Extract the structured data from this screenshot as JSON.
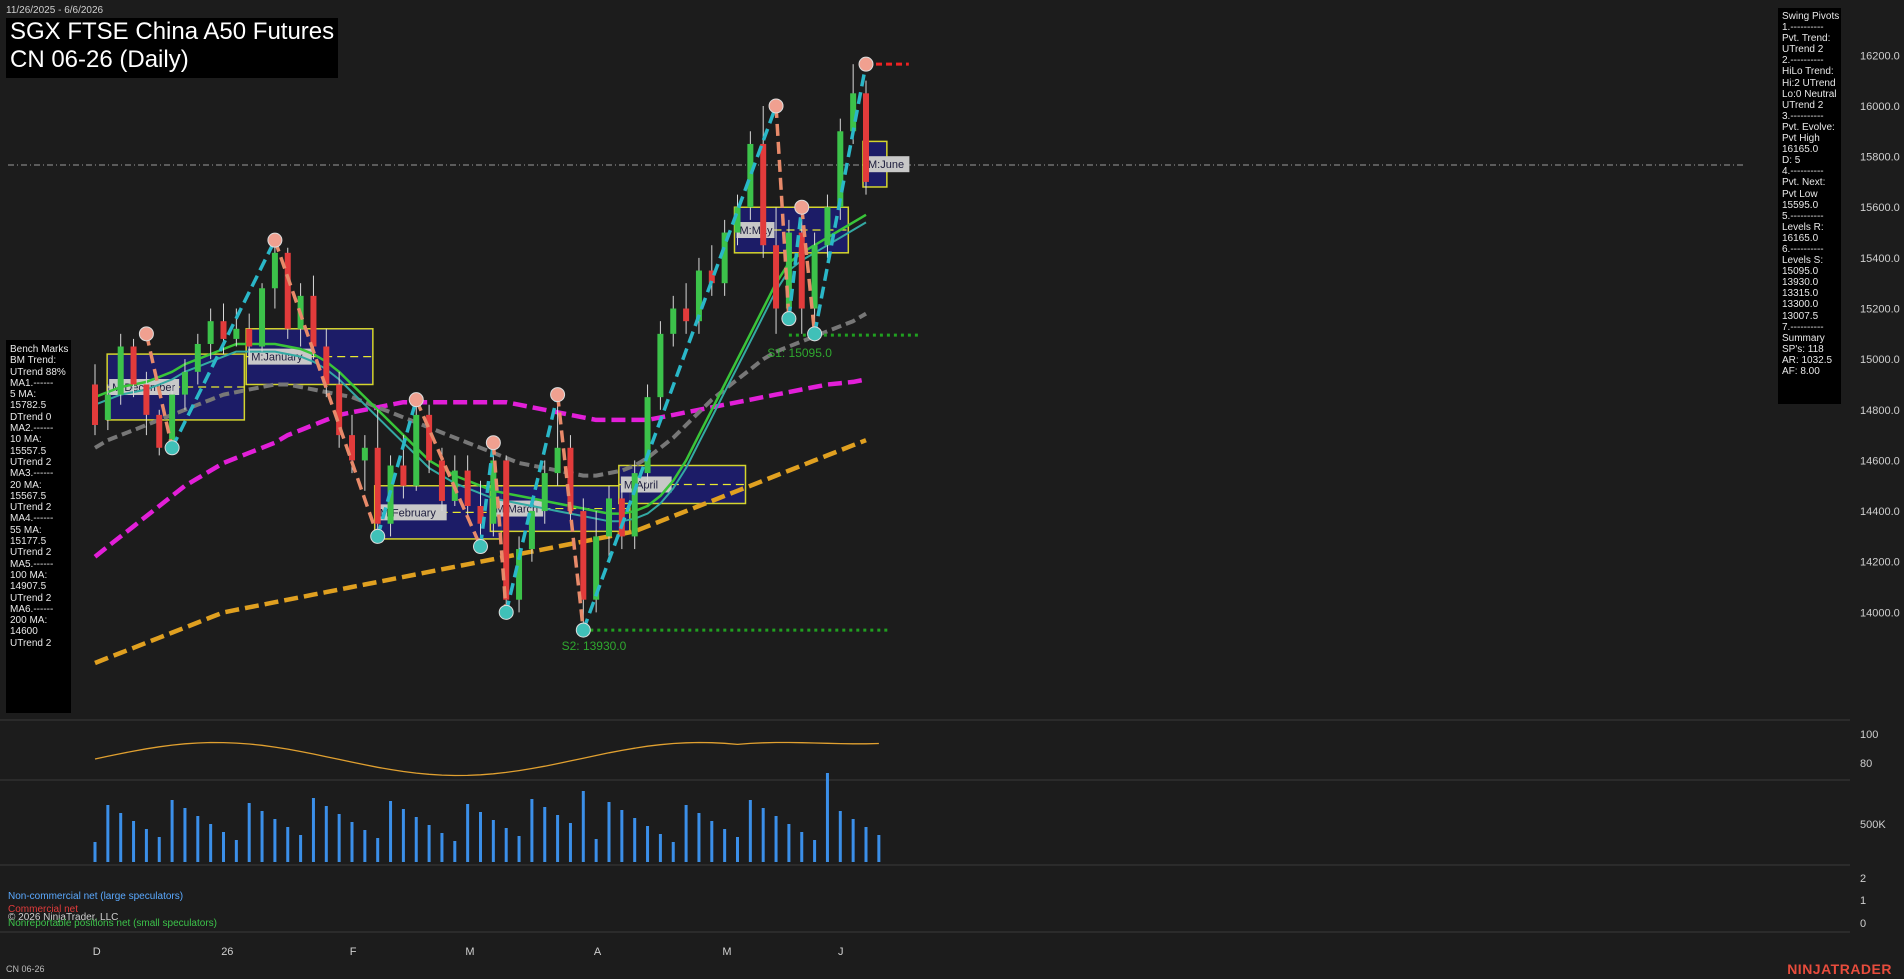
{
  "header": {
    "date_range": "11/26/2025 - 6/6/2026",
    "title_line1": "SGX FTSE China A50 Futures",
    "title_line2": "CN 06-26 (Daily)"
  },
  "benchmarks": {
    "title": "Bench Marks",
    "lines": [
      "BM Trend:",
      "UTrend 88%",
      "MA1.------",
      "5 MA:",
      "15782.5",
      "DTrend 0",
      "MA2.------",
      "10 MA:",
      "15557.5",
      "UTrend 2",
      "MA3.------",
      "20 MA:",
      "15567.5",
      "UTrend 2",
      "MA4.------",
      "55 MA:",
      "15177.5",
      "UTrend 2",
      "MA5.------",
      "100 MA:",
      "14907.5",
      "UTrend 2",
      "MA6.------",
      "200 MA:",
      "14600",
      "UTrend 2"
    ]
  },
  "swing_pivots": {
    "lines": [
      "Swing Pivots",
      "1.----------",
      "Pvt. Trend:",
      "UTrend 2",
      "2.----------",
      "HiLo Trend:",
      "Hi:2 UTrend",
      "Lo:0 Neutral",
      "UTrend 2",
      "3.----------",
      "Pvt. Evolve:",
      "Pvt High",
      "16165.0",
      "D: 5",
      "4.----------",
      "Pvt. Next:",
      "Pvt Low",
      "15595.0",
      "5.----------",
      "Levels R:",
      "16165.0",
      "6.----------",
      "Levels S:",
      "15095.0",
      "13930.0",
      "13315.0",
      "13300.0",
      "13007.5",
      "7.----------",
      "Summary",
      "SP's: 118",
      "AR: 1032.5",
      "AF: 8.00"
    ]
  },
  "month_boxes": [
    {
      "label": "M:December",
      "lo": 14760,
      "hi": 15020,
      "start": -1,
      "end": 11
    },
    {
      "label": "M:January",
      "lo": 14900,
      "hi": 15120,
      "start": 12,
      "end": 21
    },
    {
      "label": "M:February",
      "lo": 14290,
      "hi": 14500,
      "start": 22,
      "end": 31
    },
    {
      "label": "M:March",
      "lo": 14320,
      "hi": 14500,
      "start": 31,
      "end": 41
    },
    {
      "label": "M:April",
      "lo": 14430,
      "hi": 14580,
      "start": 41,
      "end": 50
    },
    {
      "label": "M:May",
      "lo": 15420,
      "hi": 15600,
      "start": 50,
      "end": 58
    },
    {
      "label": "M:June",
      "lo": 15680,
      "hi": 15860,
      "start": 60,
      "end": 61
    }
  ],
  "levels": {
    "s1_label": "S1: 15095.0",
    "s2_label": "S2: 13930.0",
    "r_marker": "16165.0"
  },
  "chart_data": {
    "type": "candlestick",
    "x_tick_labels": [
      {
        "label": "D",
        "index": 2
      },
      {
        "label": "26",
        "index": 12
      },
      {
        "label": "F",
        "index": 22
      },
      {
        "label": "M",
        "index": 31
      },
      {
        "label": "A",
        "index": 41
      },
      {
        "label": "M",
        "index": 51
      },
      {
        "label": "J",
        "index": 60
      }
    ],
    "y_ticks": [
      14000,
      14200,
      14400,
      14600,
      14800,
      15000,
      15200,
      15400,
      15600,
      15800,
      16000,
      16200
    ],
    "ylim": [
      13800,
      16300
    ],
    "candles": [
      {
        "o": 14900,
        "h": 14980,
        "l": 14700,
        "c": 14740
      },
      {
        "o": 14760,
        "h": 14900,
        "l": 14720,
        "c": 14860
      },
      {
        "o": 14860,
        "h": 15100,
        "l": 14820,
        "c": 15050
      },
      {
        "o": 15050,
        "h": 15080,
        "l": 14850,
        "c": 14900
      },
      {
        "o": 14900,
        "h": 14950,
        "l": 14700,
        "c": 14780
      },
      {
        "o": 14780,
        "h": 14800,
        "l": 14620,
        "c": 14650
      },
      {
        "o": 14650,
        "h": 14900,
        "l": 14630,
        "c": 14860
      },
      {
        "o": 14860,
        "h": 15000,
        "l": 14800,
        "c": 14950
      },
      {
        "o": 14950,
        "h": 15100,
        "l": 14900,
        "c": 15060
      },
      {
        "o": 15060,
        "h": 15200,
        "l": 15000,
        "c": 15150
      },
      {
        "o": 15150,
        "h": 15220,
        "l": 15020,
        "c": 15080
      },
      {
        "o": 15080,
        "h": 15200,
        "l": 15050,
        "c": 15120
      },
      {
        "o": 15120,
        "h": 15180,
        "l": 15000,
        "c": 15050
      },
      {
        "o": 15050,
        "h": 15300,
        "l": 15030,
        "c": 15280
      },
      {
        "o": 15280,
        "h": 15460,
        "l": 15200,
        "c": 15420
      },
      {
        "o": 15420,
        "h": 15440,
        "l": 15080,
        "c": 15120
      },
      {
        "o": 15120,
        "h": 15300,
        "l": 15050,
        "c": 15250
      },
      {
        "o": 15250,
        "h": 15330,
        "l": 15000,
        "c": 15050
      },
      {
        "o": 15050,
        "h": 15120,
        "l": 14850,
        "c": 14900
      },
      {
        "o": 14900,
        "h": 14950,
        "l": 14650,
        "c": 14700
      },
      {
        "o": 14700,
        "h": 14780,
        "l": 14550,
        "c": 14600
      },
      {
        "o": 14600,
        "h": 14700,
        "l": 14480,
        "c": 14650
      },
      {
        "o": 14650,
        "h": 14800,
        "l": 14300,
        "c": 14350
      },
      {
        "o": 14350,
        "h": 14620,
        "l": 14300,
        "c": 14580
      },
      {
        "o": 14580,
        "h": 14700,
        "l": 14450,
        "c": 14500
      },
      {
        "o": 14500,
        "h": 14820,
        "l": 14480,
        "c": 14780
      },
      {
        "o": 14780,
        "h": 14820,
        "l": 14550,
        "c": 14600
      },
      {
        "o": 14600,
        "h": 14650,
        "l": 14400,
        "c": 14440
      },
      {
        "o": 14440,
        "h": 14620,
        "l": 14420,
        "c": 14560
      },
      {
        "o": 14560,
        "h": 14620,
        "l": 14380,
        "c": 14420
      },
      {
        "o": 14420,
        "h": 14520,
        "l": 14280,
        "c": 14350
      },
      {
        "o": 14350,
        "h": 14620,
        "l": 14300,
        "c": 14600
      },
      {
        "o": 14600,
        "h": 14620,
        "l": 14000,
        "c": 14050
      },
      {
        "o": 14050,
        "h": 14300,
        "l": 14000,
        "c": 14250
      },
      {
        "o": 14250,
        "h": 14450,
        "l": 14200,
        "c": 14400
      },
      {
        "o": 14400,
        "h": 14600,
        "l": 14350,
        "c": 14550
      },
      {
        "o": 14550,
        "h": 14850,
        "l": 14500,
        "c": 14650
      },
      {
        "o": 14650,
        "h": 14700,
        "l": 14350,
        "c": 14400
      },
      {
        "o": 14400,
        "h": 14450,
        "l": 13950,
        "c": 14050
      },
      {
        "o": 14050,
        "h": 14400,
        "l": 14000,
        "c": 14300
      },
      {
        "o": 14300,
        "h": 14500,
        "l": 14220,
        "c": 14450
      },
      {
        "o": 14450,
        "h": 14500,
        "l": 14250,
        "c": 14300
      },
      {
        "o": 14300,
        "h": 14600,
        "l": 14250,
        "c": 14550
      },
      {
        "o": 14550,
        "h": 14900,
        "l": 14500,
        "c": 14850
      },
      {
        "o": 14850,
        "h": 15150,
        "l": 14800,
        "c": 15100
      },
      {
        "o": 15100,
        "h": 15250,
        "l": 15050,
        "c": 15200
      },
      {
        "o": 15200,
        "h": 15300,
        "l": 15100,
        "c": 15150
      },
      {
        "o": 15150,
        "h": 15400,
        "l": 15100,
        "c": 15350
      },
      {
        "o": 15350,
        "h": 15450,
        "l": 15250,
        "c": 15300
      },
      {
        "o": 15300,
        "h": 15550,
        "l": 15250,
        "c": 15500
      },
      {
        "o": 15500,
        "h": 15650,
        "l": 15450,
        "c": 15600
      },
      {
        "o": 15600,
        "h": 15900,
        "l": 15550,
        "c": 15850
      },
      {
        "o": 15850,
        "h": 16000,
        "l": 15400,
        "c": 15450
      },
      {
        "o": 15450,
        "h": 15600,
        "l": 15100,
        "c": 15200
      },
      {
        "o": 15200,
        "h": 15550,
        "l": 15150,
        "c": 15500
      },
      {
        "o": 15500,
        "h": 15550,
        "l": 15100,
        "c": 15200
      },
      {
        "o": 15200,
        "h": 15500,
        "l": 15100,
        "c": 15450
      },
      {
        "o": 15450,
        "h": 15650,
        "l": 15400,
        "c": 15600
      },
      {
        "o": 15600,
        "h": 15950,
        "l": 15550,
        "c": 15900
      },
      {
        "o": 15900,
        "h": 16165,
        "l": 15850,
        "c": 16050
      },
      {
        "o": 16050,
        "h": 16100,
        "l": 15650,
        "c": 15700
      }
    ],
    "ma20": [
      14850,
      14870,
      14890,
      14900,
      14910,
      14930,
      14950,
      14980,
      15000,
      15020,
      15040,
      15060,
      15060,
      15060,
      15060,
      15050,
      15040,
      15020,
      14990,
      14950,
      14900,
      14850,
      14800,
      14750,
      14700,
      14650,
      14600,
      14570,
      14540,
      14520,
      14500,
      14480,
      14470,
      14460,
      14450,
      14440,
      14430,
      14420,
      14410,
      14400,
      14390,
      14390,
      14400,
      14420,
      14460,
      14520,
      14600,
      14700,
      14800,
      14900,
      15000,
      15100,
      15200,
      15300,
      15380,
      15420,
      15450,
      15480,
      15510,
      15540,
      15570
    ],
    "ma55": [
      14650,
      14680,
      14700,
      14720,
      14740,
      14760,
      14780,
      14800,
      14820,
      14840,
      14860,
      14870,
      14880,
      14890,
      14900,
      14900,
      14890,
      14880,
      14870,
      14860,
      14850,
      14830,
      14810,
      14790,
      14770,
      14750,
      14730,
      14710,
      14690,
      14670,
      14650,
      14630,
      14610,
      14590,
      14580,
      14570,
      14560,
      14550,
      14540,
      14540,
      14550,
      14560,
      14580,
      14610,
      14650,
      14690,
      14740,
      14790,
      14840,
      14880,
      14920,
      14960,
      15000,
      15030,
      15050,
      15070,
      15090,
      15110,
      15130,
      15150,
      15180
    ],
    "ma100": [
      14220,
      14260,
      14300,
      14340,
      14380,
      14420,
      14460,
      14500,
      14530,
      14560,
      14590,
      14610,
      14630,
      14650,
      14670,
      14700,
      14720,
      14740,
      14760,
      14780,
      14790,
      14800,
      14810,
      14820,
      14830,
      14830,
      14830,
      14830,
      14830,
      14830,
      14830,
      14830,
      14830,
      14820,
      14810,
      14800,
      14790,
      14780,
      14770,
      14760,
      14760,
      14760,
      14760,
      14760,
      14770,
      14780,
      14790,
      14800,
      14810,
      14820,
      14830,
      14840,
      14850,
      14860,
      14870,
      14880,
      14890,
      14900,
      14905,
      14910,
      14920
    ],
    "ma200": [
      13800,
      13820,
      13840,
      13860,
      13880,
      13900,
      13920,
      13940,
      13960,
      13980,
      14000,
      14010,
      14020,
      14030,
      14040,
      14050,
      14060,
      14070,
      14080,
      14090,
      14100,
      14110,
      14120,
      14130,
      14140,
      14150,
      14160,
      14170,
      14180,
      14190,
      14200,
      14210,
      14220,
      14230,
      14240,
      14250,
      14260,
      14270,
      14280,
      14290,
      14300,
      14310,
      14320,
      14340,
      14360,
      14380,
      14400,
      14420,
      14440,
      14460,
      14480,
      14500,
      14520,
      14540,
      14560,
      14580,
      14600,
      14620,
      14640,
      14660,
      14680
    ],
    "swing_pivots": [
      {
        "i": 4,
        "v": 15100,
        "type": "high"
      },
      {
        "i": 6,
        "v": 14650,
        "type": "low"
      },
      {
        "i": 14,
        "v": 15470,
        "type": "high"
      },
      {
        "i": 22,
        "v": 14300,
        "type": "low"
      },
      {
        "i": 25,
        "v": 14840,
        "type": "high"
      },
      {
        "i": 30,
        "v": 14260,
        "type": "low"
      },
      {
        "i": 31,
        "v": 14670,
        "type": "high"
      },
      {
        "i": 32,
        "v": 14000,
        "type": "low"
      },
      {
        "i": 36,
        "v": 14860,
        "type": "high"
      },
      {
        "i": 38,
        "v": 13930,
        "type": "low"
      },
      {
        "i": 53,
        "v": 16000,
        "type": "high"
      },
      {
        "i": 54,
        "v": 15160,
        "type": "low"
      },
      {
        "i": 55,
        "v": 15600,
        "type": "high"
      },
      {
        "i": 56,
        "v": 15100,
        "type": "low"
      },
      {
        "i": 60,
        "v": 16165,
        "type": "high"
      }
    ],
    "oscillator": {
      "labels": [
        "100",
        "80"
      ]
    },
    "volume": {
      "label": "500K"
    },
    "cot": {
      "labels": [
        "2",
        "1",
        "0"
      ]
    }
  },
  "cot_legend": {
    "noncommercial": "Non-commercial net (large speculators)",
    "commercial": "Commercial net",
    "nonreportable": "Nonreportable positions net (small speculators)",
    "copyright": "© 2026 NinjaTrader, LLC"
  },
  "footer": {
    "symbol": "CN 06-26",
    "brand": "NINJATRADER"
  },
  "colors": {
    "background": "#1c1c1c",
    "up": "#3cc24a",
    "down": "#e23b3b",
    "ma20": "#39c539",
    "ma55": "#33a9a3",
    "ma100": "#e21fd8",
    "ma200": "#e0a020",
    "ma_gray": "#777777",
    "box_fill": "#1d1d70",
    "box_border": "#e8e830",
    "pivot_up_line": "#2ab7c8",
    "pivot_down_line": "#e88a6a"
  }
}
